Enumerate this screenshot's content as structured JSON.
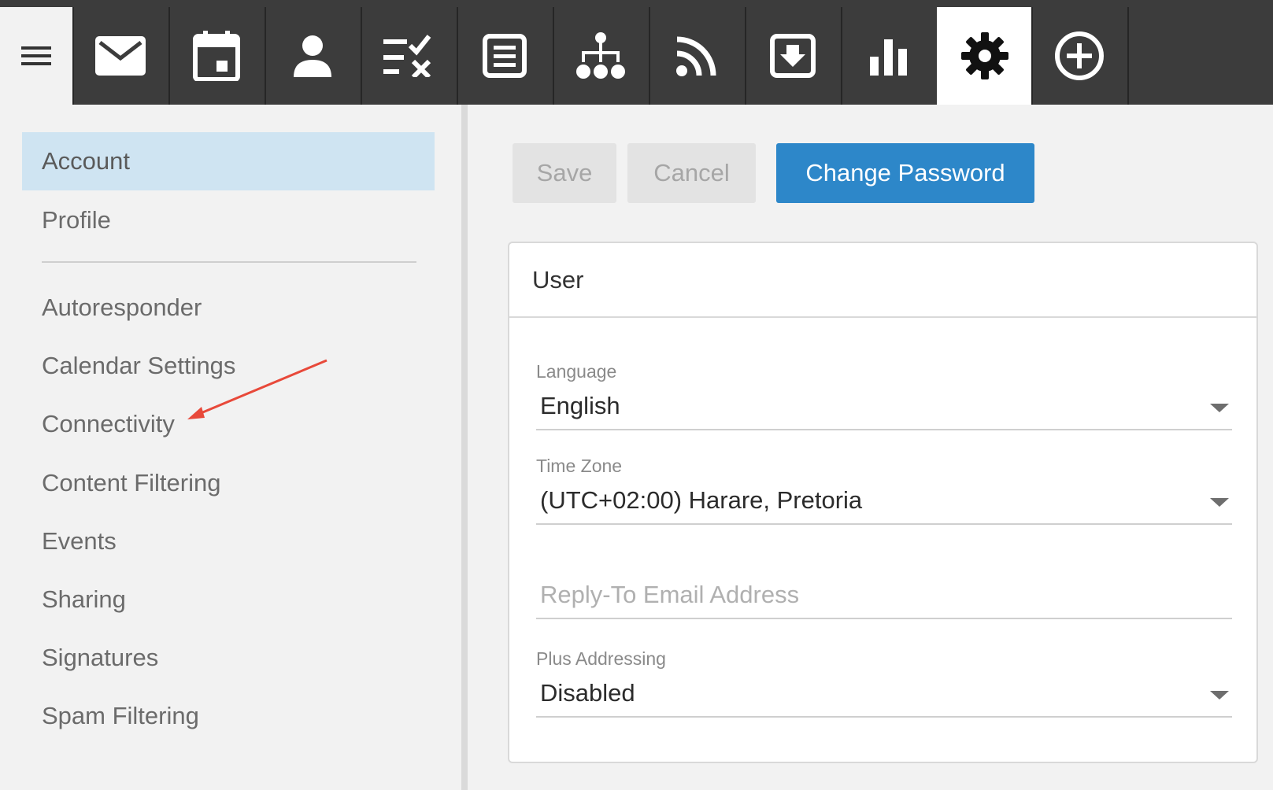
{
  "topbar": {
    "menu_icon": "hamburger-menu-icon",
    "tabs": [
      {
        "icon": "mail-icon"
      },
      {
        "icon": "calendar-icon"
      },
      {
        "icon": "contacts-icon"
      },
      {
        "icon": "tasks-icon"
      },
      {
        "icon": "notes-icon"
      },
      {
        "icon": "org-chart-icon"
      },
      {
        "icon": "rss-icon"
      },
      {
        "icon": "file-storage-icon"
      },
      {
        "icon": "reports-icon"
      },
      {
        "icon": "settings-gear-icon",
        "active": true
      },
      {
        "icon": "add-circle-icon"
      }
    ]
  },
  "sidebar": {
    "items": [
      {
        "label": "Account",
        "selected": true
      },
      {
        "label": "Profile"
      },
      {
        "label": "Autoresponder"
      },
      {
        "label": "Calendar Settings"
      },
      {
        "label": "Connectivity"
      },
      {
        "label": "Content Filtering"
      },
      {
        "label": "Events"
      },
      {
        "label": "Sharing"
      },
      {
        "label": "Signatures"
      },
      {
        "label": "Spam Filtering"
      }
    ]
  },
  "toolbar": {
    "save_label": "Save",
    "cancel_label": "Cancel",
    "change_password_label": "Change Password"
  },
  "user_card": {
    "title": "User",
    "language": {
      "label": "Language",
      "value": "English"
    },
    "time_zone": {
      "label": "Time Zone",
      "value": "(UTC+02:00) Harare, Pretoria"
    },
    "reply_to": {
      "placeholder": "Reply-To Email Address",
      "value": ""
    },
    "plus_addressing": {
      "label": "Plus Addressing",
      "value": "Disabled"
    }
  },
  "colors": {
    "topbar_bg": "#3c3c3c",
    "accent_blue": "#2d87c9",
    "selected_nav_bg": "#cfe4f2",
    "annotation_arrow": "#e8493a"
  }
}
